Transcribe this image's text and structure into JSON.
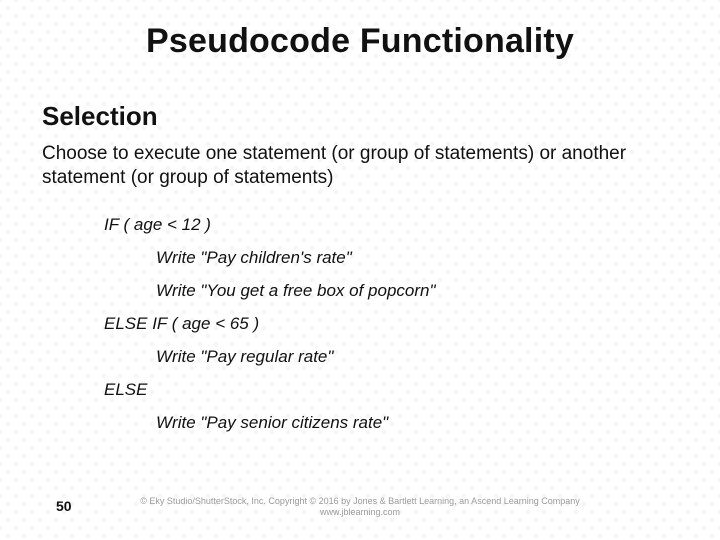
{
  "title": "Pseudocode Functionality",
  "section": "Selection",
  "description": "Choose to execute one statement (or group of statements) or another statement (or group of statements)",
  "code": {
    "l1": "IF ( age < 12 )",
    "l2": "Write \"Pay children's rate\"",
    "l3": "Write \"You get a free box of popcorn\"",
    "l4": "ELSE IF ( age < 65 )",
    "l5": "Write \"Pay regular rate\"",
    "l6": "ELSE",
    "l7": "Write \"Pay senior citizens rate\""
  },
  "page_number": "50",
  "copyright_line": "© Eky Studio/ShutterStock, Inc. Copyright © 2016 by Jones & Bartlett Learning, an Ascend Learning Company",
  "copyright_url": "www.jblearning.com"
}
